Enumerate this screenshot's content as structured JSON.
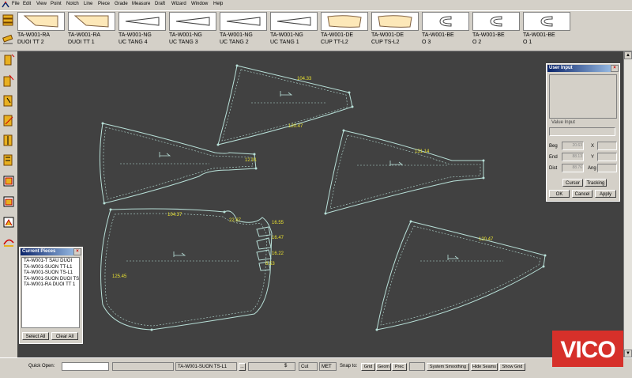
{
  "menubar": {
    "items": [
      "File",
      "Edit",
      "View",
      "Point",
      "Notch",
      "Line",
      "Piece",
      "Grade",
      "Measure",
      "Draft",
      "Wizard",
      "Window",
      "Help"
    ]
  },
  "pieces_bar": {
    "pieces": [
      {
        "label": "TA-W001-RA\nDUOI TT 2",
        "shape": "flag"
      },
      {
        "label": "TA-W001-RA\nDUOI TT 1",
        "shape": "flag"
      },
      {
        "label": "TA-W001-NG\nUC TANG 4",
        "shape": "wedge"
      },
      {
        "label": "TA-W001-NG\nUC TANG 3",
        "shape": "wedge"
      },
      {
        "label": "TA-W001-NG\nUC TANG 2",
        "shape": "wedge"
      },
      {
        "label": "TA-W001-NG\nUC TANG 1",
        "shape": "wedge"
      },
      {
        "label": "TA-W001-DE\nCUP TT-L2",
        "shape": "cup"
      },
      {
        "label": "TA-W001-DE\nCUP TS-L2",
        "shape": "cup"
      },
      {
        "label": "TA-W001-BE\nO 3",
        "shape": "c"
      },
      {
        "label": "TA-W001-BE\nO 2",
        "shape": "c"
      },
      {
        "label": "TA-W001-BE\nO 1",
        "shape": "c"
      }
    ]
  },
  "canvas": {
    "measurements": {
      "m1": "104.33",
      "m2": "120.47",
      "m3": "12.91",
      "m4": "131.14",
      "m5": "104.37",
      "m6": "22.87",
      "m7": "16.55",
      "m8": "16.47",
      "m9": "16.22",
      "m10": "6.53",
      "m11": "125.45",
      "m12": "120.47"
    }
  },
  "user_input": {
    "title": "User Input",
    "value_input_label": "Value Input",
    "beg_label": "Beg",
    "end_label": "End",
    "dist_label": "Dist",
    "x_label": "X",
    "y_label": "Y",
    "ang_label": "Ang",
    "beg_value": "20.63",
    "end_value": "88.13",
    "dist_value": "88.76",
    "cursor_btn": "Cursor",
    "tracking_btn": "Tracking",
    "ok_btn": "OK",
    "cancel_btn": "Cancel",
    "apply_btn": "Apply"
  },
  "current_pieces": {
    "title": "Current Pieces",
    "items": [
      "TA-W001-T SAU DUOI",
      "TA-W001-SUON TT-L1",
      "TA-W001-SUON TS-L1",
      "TA-W001-SUON DUOI TS",
      "TA-W001-RA DUOI TT 1"
    ],
    "select_all": "Select All",
    "clear_all": "Clear All"
  },
  "statusbar": {
    "quick_open_label": "Quick Open:",
    "quick_open_value": "",
    "current_piece": "TA-W001-SUON TS-L1",
    "browse_btn": "...",
    "currency": "$",
    "cut_btn": "Cut",
    "units": "MET",
    "snap_label": "Snap to:",
    "grid_btn": "Grid",
    "geom_btn": "Geom",
    "prec_btn": "Prec",
    "smoothing_btn": "System Smoothing",
    "hide_seams_btn": "Hide Seams",
    "show_grid_btn": "Show Grid"
  },
  "logo": {
    "text": "VICO"
  },
  "colors": {
    "canvas": "#414141",
    "piece_line": "#b8e0d8",
    "measure_text": "#e8e030",
    "accent": "#d6302a"
  }
}
